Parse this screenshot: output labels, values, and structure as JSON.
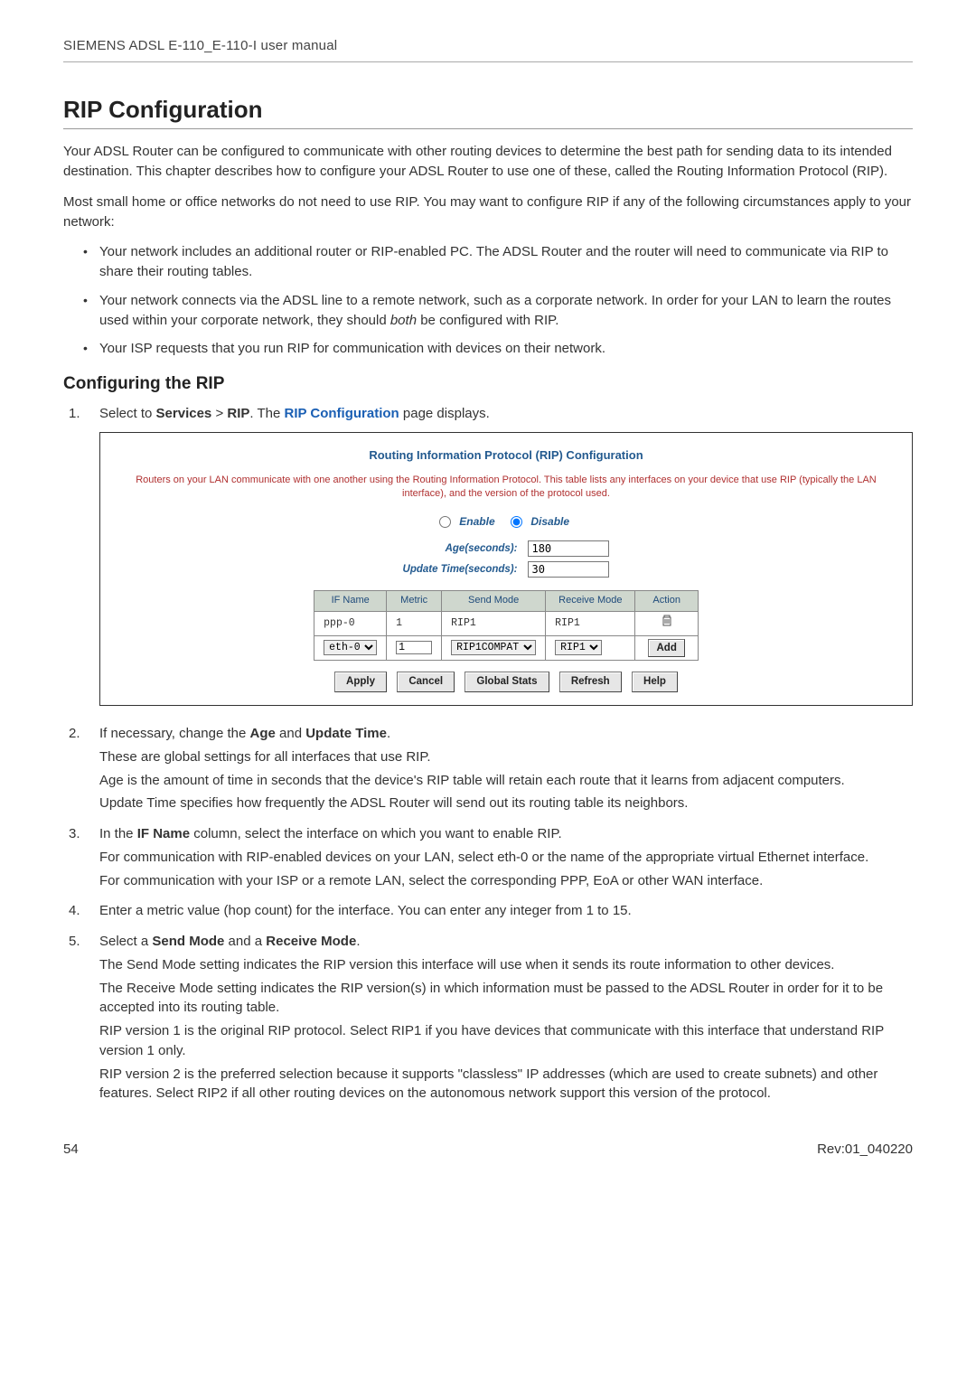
{
  "header": "SIEMENS ADSL E-110_E-110-I user manual",
  "title": "RIP Configuration",
  "intro1": "Your ADSL Router can be configured to communicate with other routing devices to determine the best path for sending data to its intended destination. This chapter describes how to configure your ADSL Router to use one of these, called the Routing Information Protocol (RIP).",
  "intro2": "Most small home or office networks do not need to use RIP. You may want to configure RIP if any of the following circumstances apply to your network:",
  "bullets": [
    "Your network includes an additional router or RIP-enabled PC. The ADSL Router and the router will need to communicate via RIP to share their routing tables.",
    "Your network connects via the ADSL line to a remote network, such as a corporate network. In order for your LAN to learn the routes used within your corporate network, they should ",
    "Your ISP requests that you run RIP for communication with devices on their network."
  ],
  "bullet2_suffix_italic": "both",
  "bullet2_suffix_tail": " be configured with RIP.",
  "sub_title": "Configuring the RIP",
  "step1_pre": "Select to ",
  "step1_b1": "Services",
  "step1_mid": " > ",
  "step1_b2": "RIP",
  "step1_tail1": ". The ",
  "step1_link": "RIP Configuration",
  "step1_tail2": " page displays.",
  "shot": {
    "title": "Routing Information Protocol (RIP) Configuration",
    "note": "Routers on your LAN communicate with one another using the Routing Information Protocol. This table lists any interfaces on your device that use RIP (typically the LAN interface), and the version of the protocol used.",
    "enable": "Enable",
    "disable": "Disable",
    "age_label": "Age(seconds):",
    "age_value": "180",
    "ut_label": "Update Time(seconds):",
    "ut_value": "30",
    "cols": {
      "ifname": "IF Name",
      "metric": "Metric",
      "send": "Send Mode",
      "recv": "Receive Mode",
      "action": "Action"
    },
    "row1": {
      "ifname": "ppp-0",
      "metric": "1",
      "send": "RIP1",
      "recv": "RIP1"
    },
    "row2": {
      "ifname": "eth-0",
      "metric": "1",
      "send": "RIP1COMPAT",
      "recv": "RIP1",
      "add": "Add"
    },
    "btns": {
      "apply": "Apply",
      "cancel": "Cancel",
      "gstats": "Global Stats",
      "refresh": "Refresh",
      "help": "Help"
    }
  },
  "step2_pre": "If necessary, change the ",
  "step2_b1": "Age",
  "step2_mid": " and ",
  "step2_b2": "Update Time",
  "step2_tail": ".",
  "step2_l1": "These are global settings for all interfaces that use RIP.",
  "step2_l2": "Age is the amount of time in seconds that the device's RIP table will retain each route that it learns from adjacent computers.",
  "step2_l3": "Update Time specifies how frequently the ADSL Router will send out its routing table its neighbors.",
  "step3_pre": "In the ",
  "step3_b1": "IF Name",
  "step3_tail": " column, select the interface on which you want to enable RIP.",
  "step3_l1": "For communication with RIP-enabled devices on your LAN, select eth-0 or the name of the appropriate virtual Ethernet interface.",
  "step3_l2": "For communication with your ISP or a remote LAN, select the corresponding PPP, EoA or other WAN interface.",
  "step4": "Enter a metric value (hop count) for the interface. You can enter any integer from 1 to 15.",
  "step5_pre": "Select a ",
  "step5_b1": "Send Mode",
  "step5_mid": " and a ",
  "step5_b2": "Receive Mode",
  "step5_tail": ".",
  "step5_l1": "The Send Mode setting indicates the RIP version this interface will use when it sends its route information to other devices.",
  "step5_l2": "The Receive Mode setting indicates the RIP version(s) in which information must be passed to the ADSL Router in order for it to be accepted into its routing table.",
  "step5_l3": "RIP version 1 is the original RIP protocol. Select RIP1 if you have devices that communicate with this interface that understand RIP version 1 only.",
  "step5_l4": "RIP version 2 is the preferred selection because it supports \"classless\" IP addresses (which are used to create subnets) and other features. Select RIP2 if all other routing devices on the autonomous network support this version of the protocol.",
  "footer": {
    "left": "54",
    "right": "Rev:01_040220"
  }
}
